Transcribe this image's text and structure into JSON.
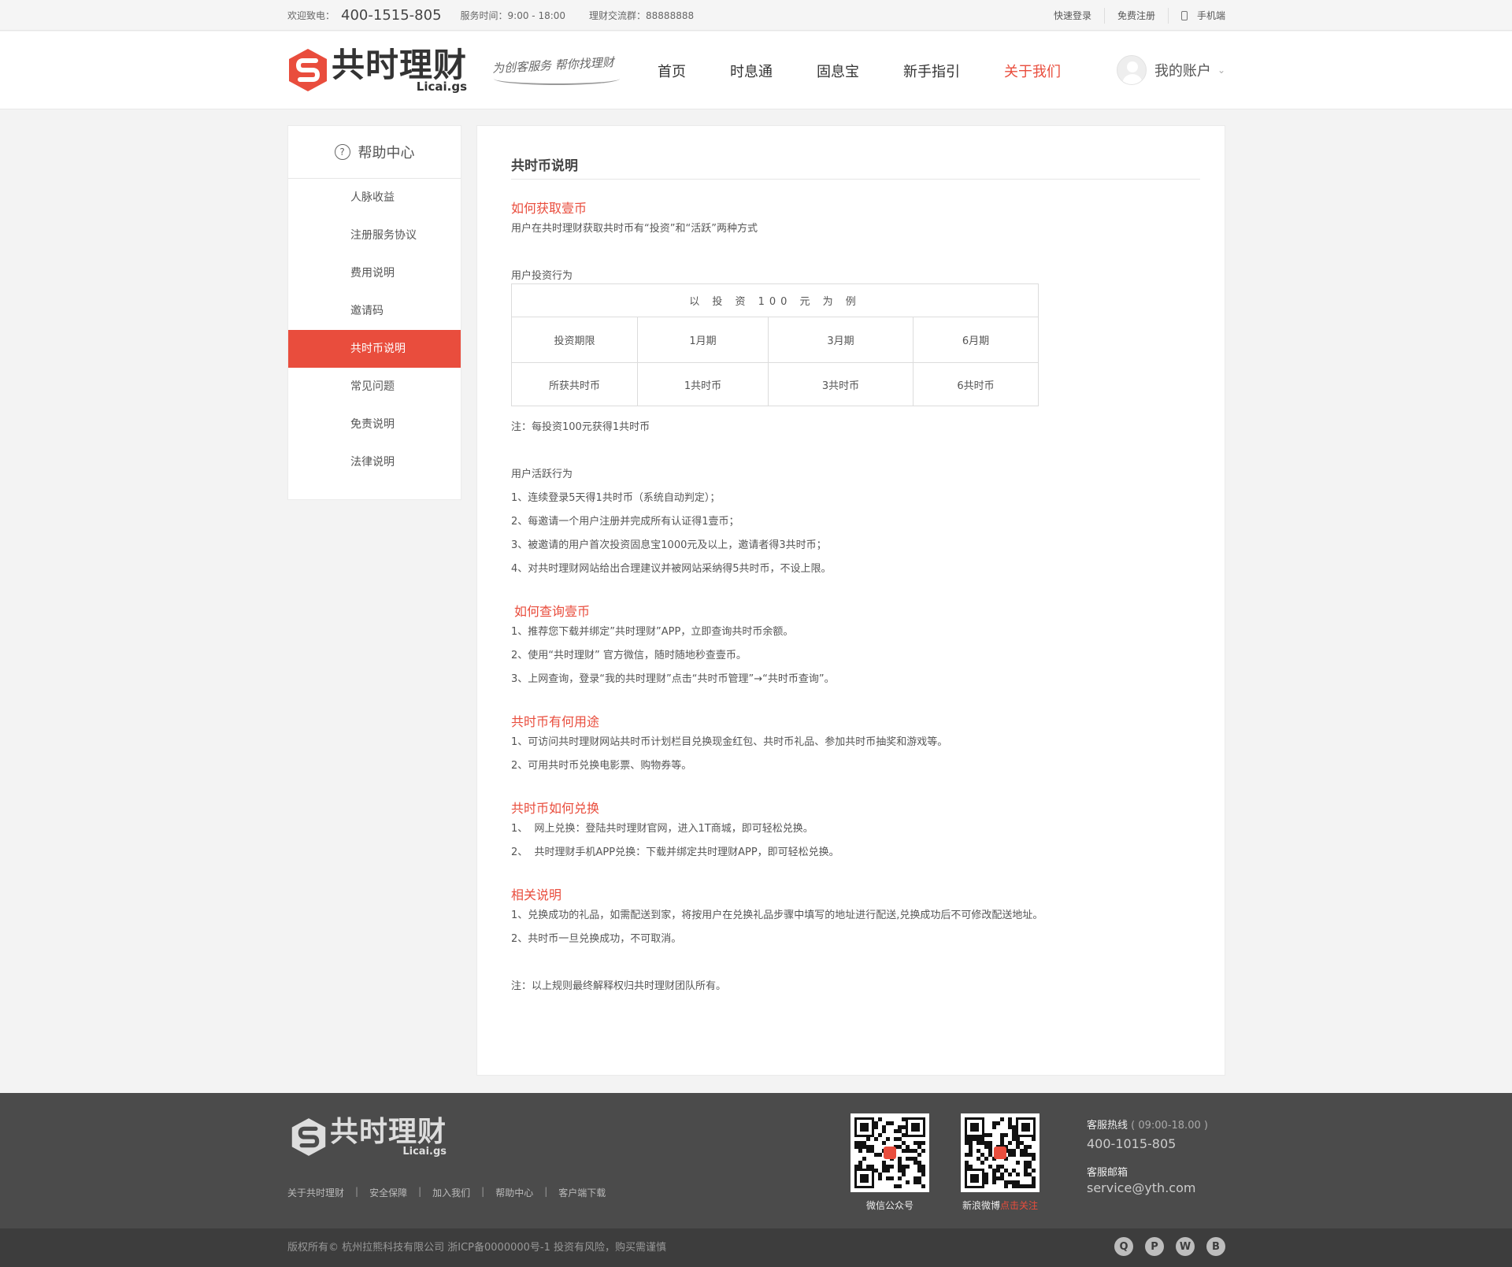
{
  "topbar": {
    "welcome_label": "欢迎致电：",
    "phone": "400-1515-805",
    "service_hours": "服务时间：9:00 - 18:00",
    "group": "理财交流群：88888888",
    "quick_login": "快速登录",
    "free_register": "免费注册",
    "mobile": "手机端"
  },
  "header": {
    "logo_cn": "共时理财",
    "logo_en": "Licai.gs",
    "slogan": "为创客服务 帮你找理财",
    "nav": [
      "首页",
      "时息通",
      "固息宝",
      "新手指引",
      "关于我们"
    ],
    "active_nav": "关于我们",
    "account": "我的账户"
  },
  "sidebar": {
    "title": "帮助中心",
    "items": [
      "人脉收益",
      "注册服务协议",
      "费用说明",
      "邀请码",
      "共时币说明",
      "常见问题",
      "免责说明",
      "法律说明"
    ],
    "active_item": "共时币说明"
  },
  "main": {
    "title": "共时币说明",
    "s1_heading": "如何获取壹币",
    "s1_text": "用户在共时理财获取共时币有“投资”和“活跃”两种方式",
    "invest_label": "用户投资行为",
    "table": {
      "caption": "以 投 资 100 元 为 例",
      "row1": [
        "投资期限",
        "1月期",
        "3月期",
        "6月期"
      ],
      "row2": [
        "所获共时币",
        "1共时币",
        "3共时币",
        "6共时币"
      ]
    },
    "invest_note": "注：每投资100元获得1共时币",
    "active_label": "用户活跃行为",
    "active_items": [
      "1、连续登录5天得1共时币（系统自动判定）；",
      "2、每邀请一个用户注册并完成所有认证得1壹币；",
      "3、被邀请的用户首次投资固息宝1000元及以上，邀请者得3共时币；",
      "4、对共时理财网站给出合理建议并被网站采纳得5共时币，不设上限。"
    ],
    "s2_heading": "如何查询壹币",
    "s2_items": [
      "1、推荐您下载并绑定”共时理财”APP，立即查询共时币余额。",
      "2、使用“共时理财” 官方微信，随时随地秒查壹币。",
      "3、上网查询，登录“我的共时理财”点击“共时币管理”→“共时币查询”。"
    ],
    "s3_heading": "共时币有何用途",
    "s3_items": [
      "1、可访问共时理财网站共时币计划栏目兑换现金红包、共时币礼品、参加共时币抽奖和游戏等。",
      "2、可用共时币兑换电影票、购物券等。"
    ],
    "s4_heading": "共时币如何兑换",
    "s4_items": [
      "1、  网上兑换：登陆共时理财官网，进入1T商城，即可轻松兑换。",
      "2、  共时理财手机APP兑换：下载并绑定共时理财APP，即可轻松兑换。"
    ],
    "s5_heading": "相关说明",
    "s5_items": [
      "1、兑换成功的礼品，如需配送到家，将按用户在兑换礼品步骤中填写的地址进行配送,兑换成功后不可修改配送地址。",
      "2、共时币一旦兑换成功，不可取消。"
    ],
    "final_note": "注：以上规则最终解释权归共时理财团队所有。"
  },
  "footer": {
    "logo_cn": "共时理财",
    "logo_en": "Licai.gs",
    "links": [
      "关于共时理财",
      "安全保障",
      "加入我们",
      "帮助中心",
      "客户端下载"
    ],
    "qr1_caption": "微信公众号",
    "qr2_caption": "新浪微博",
    "qr2_follow": "点击关注",
    "hotline_label": "客服热线",
    "hotline_hours": "( 09:00-18.00 )",
    "hotline": "400-1015-805",
    "email_label": "客服邮箱",
    "email": "service@yth.com",
    "copyright": "版权所有© 杭州拉熊科技有限公司  浙ICP备0000000号-1  投资有风险，购买需谨慎"
  },
  "colors": {
    "accent": "#e94d3d",
    "footer_bg": "#4b4b4b",
    "bottom_bg": "#3d3d3d"
  },
  "icons": [
    "phone-icon",
    "question-icon",
    "avatar-icon",
    "qq-icon",
    "pinterest-icon",
    "wechat-icon",
    "weibo-icon"
  ]
}
